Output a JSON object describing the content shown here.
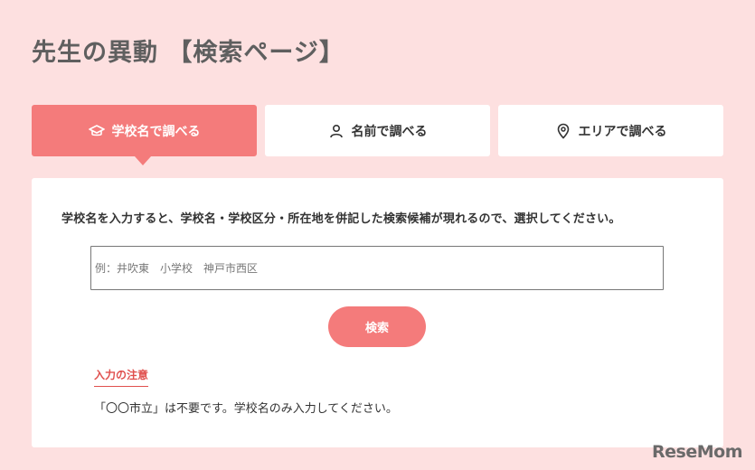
{
  "header": {
    "title": "先生の異動 【検索ページ】"
  },
  "tabs": [
    {
      "label": "学校名で調べる",
      "icon": "graduation-cap-icon",
      "active": true
    },
    {
      "label": "名前で調べる",
      "icon": "person-icon",
      "active": false
    },
    {
      "label": "エリアで調べる",
      "icon": "map-pin-icon",
      "active": false
    }
  ],
  "search": {
    "instruction": "学校名を入力すると、学校名・学校区分・所在地を併記した検索候補が現れるので、選択してください。",
    "placeholder": "例：井吹東　小学校　神戸市西区",
    "button_label": "検索"
  },
  "note": {
    "heading": "入力の注意",
    "text": "「〇〇市立」は不要です。学校名のみ入力してください。"
  },
  "watermark": {
    "text": "ReseMom"
  },
  "colors": {
    "accent": "#f47b7b",
    "background": "#fde0e0",
    "note_heading": "#e0504e"
  }
}
